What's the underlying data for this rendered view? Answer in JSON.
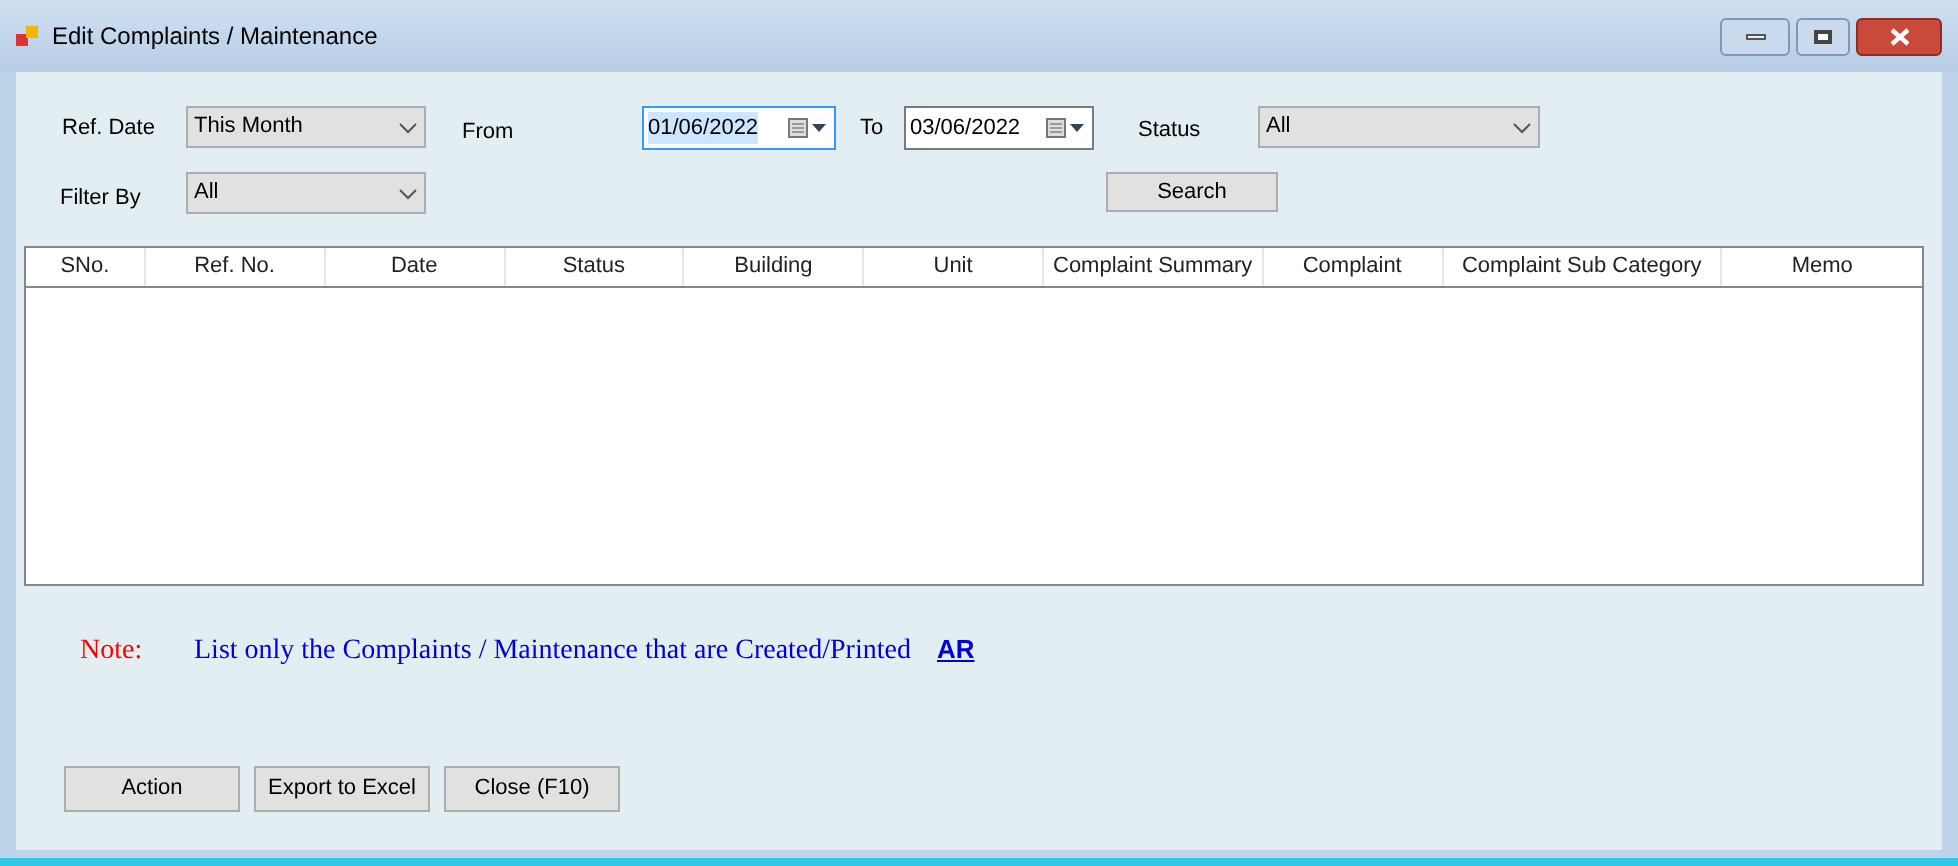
{
  "window": {
    "title": "Edit Complaints / Maintenance"
  },
  "filters": {
    "ref_date": {
      "label": "Ref. Date",
      "value": "This Month"
    },
    "from": {
      "label": "From",
      "value": "01/06/2022",
      "focused": true
    },
    "to": {
      "label": "To",
      "value": "03/06/2022",
      "focused": false
    },
    "status": {
      "label": "Status",
      "value": "All"
    },
    "filter_by": {
      "label": "Filter By",
      "value": "All"
    },
    "search_button": "Search"
  },
  "table": {
    "columns": [
      "SNo.",
      "Ref. No.",
      "Date",
      "Status",
      "Building",
      "Unit",
      "Complaint Summary",
      "Complaint",
      "Complaint Sub Category",
      "Memo"
    ]
  },
  "note": {
    "label": "Note:",
    "text": "List only the Complaints / Maintenance that are Created/Printed",
    "link": "AR"
  },
  "buttons": [
    "Action",
    "Export to Excel",
    "Close (F10)"
  ]
}
